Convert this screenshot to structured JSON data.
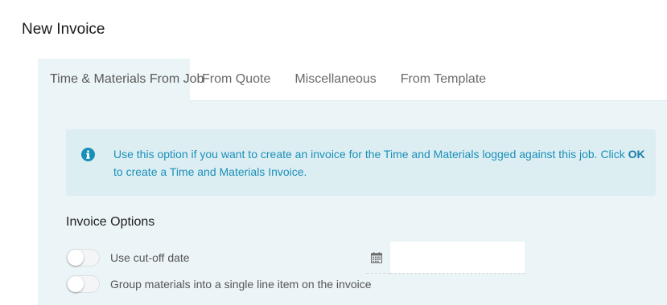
{
  "page": {
    "title": "New Invoice"
  },
  "tabs": [
    {
      "label": "Time & Materials From Job",
      "active": true
    },
    {
      "label": "From Quote",
      "active": false
    },
    {
      "label": "Miscellaneous",
      "active": false
    },
    {
      "label": "From Template",
      "active": false
    }
  ],
  "info": {
    "icon": "info-circle-icon",
    "text_before": "Use this option if you want to create an invoice for the Time and Materials logged against this job. Click ",
    "bold": "OK",
    "text_after": " to create a Time and Materials Invoice."
  },
  "options": {
    "heading": "Invoice Options",
    "cutoff": {
      "label": "Use cut-off date",
      "enabled": false,
      "date_value": ""
    },
    "group_materials": {
      "label": "Group materials into a single line item on the invoice",
      "enabled": false
    }
  },
  "colors": {
    "panel_bg": "#ebf4f6",
    "info_bg": "#ddeef3",
    "info_text": "#1a8fb8"
  }
}
